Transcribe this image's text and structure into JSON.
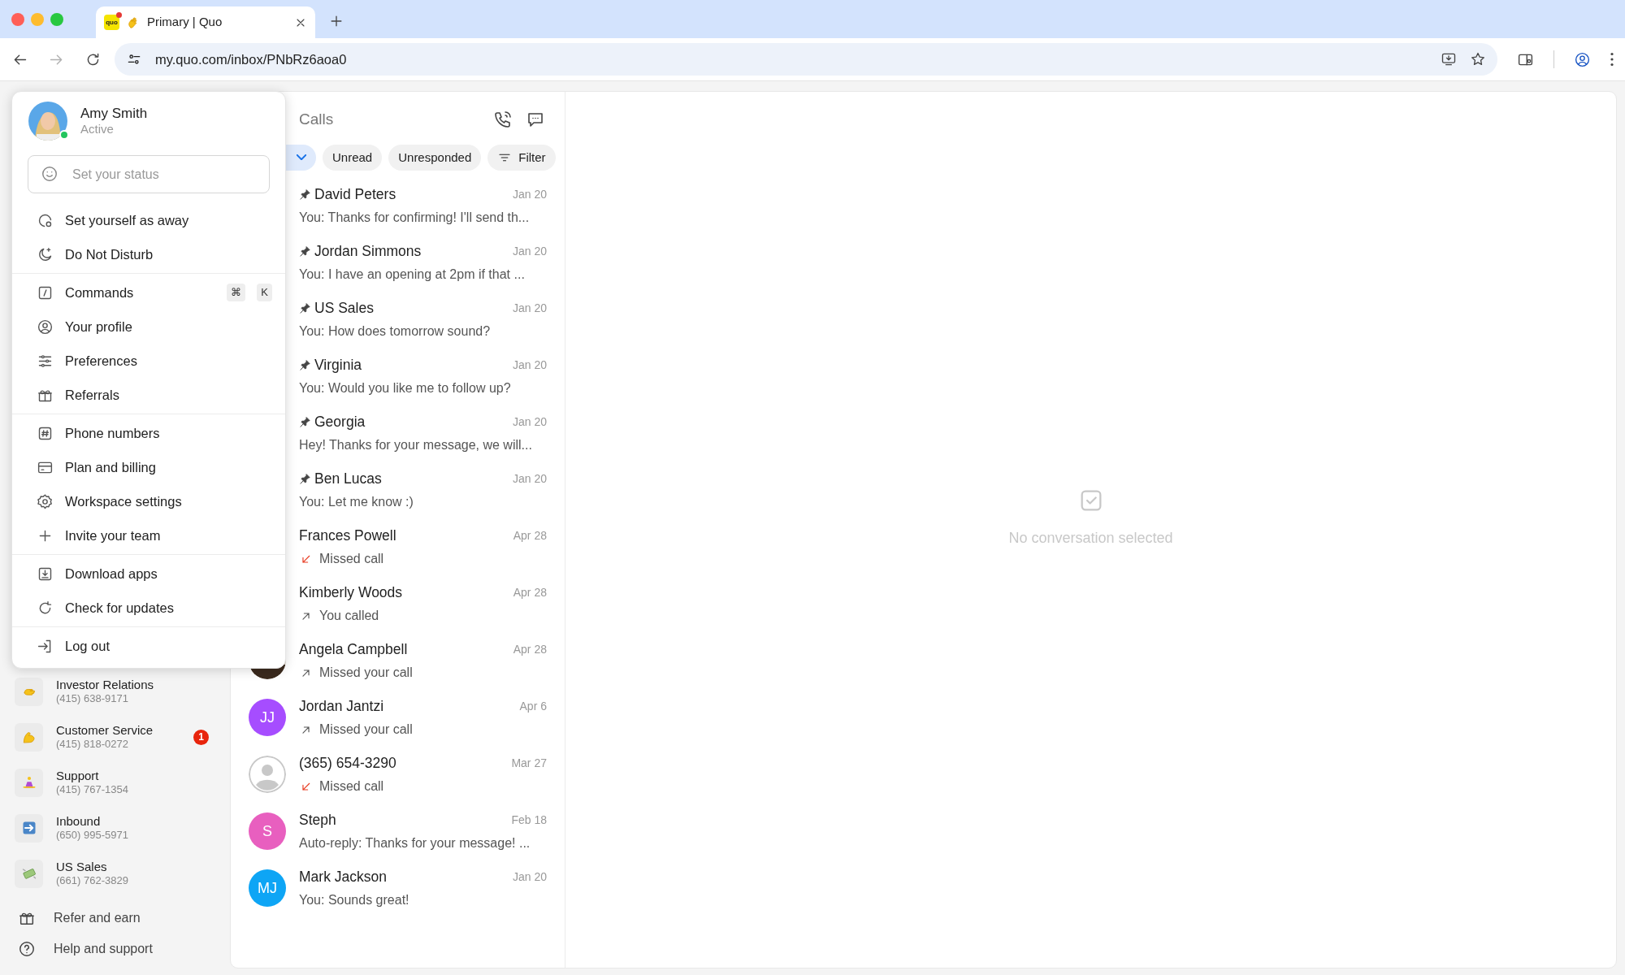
{
  "browser": {
    "tab": {
      "favicon": "quo",
      "title": "Primary | Quo"
    },
    "url_host": "my.quo.com",
    "url_path": "/inbox/PNbRz6aoa0",
    "forward_disabled": true
  },
  "sidebar": {
    "numbers": [
      {
        "name": "Investor Relations",
        "phone": "(415) 638-9171"
      },
      {
        "name": "Customer Service",
        "phone": "(415) 818-0272",
        "badge": "1"
      },
      {
        "name": "Support",
        "phone": "(415) 767-1354"
      },
      {
        "name": "Inbound",
        "phone": "(650) 995-5971"
      },
      {
        "name": "US Sales",
        "phone": "(661) 762-3829"
      }
    ],
    "links": [
      {
        "label": "Refer and earn"
      },
      {
        "label": "Help and support"
      }
    ]
  },
  "inbox": {
    "title": "Calls",
    "filters": [
      {
        "kind": "dropdown",
        "selected": true
      },
      {
        "kind": "chip",
        "label": "Unread",
        "selected": false
      },
      {
        "kind": "chip",
        "label": "Unresponded",
        "selected": false
      },
      {
        "kind": "filter",
        "label": "Filter",
        "selected": false
      }
    ],
    "conversations": [
      {
        "name": "David Peters",
        "date": "Jan 20",
        "preview": "You: Thanks for confirming! I'll send th...",
        "pinned": true
      },
      {
        "name": "Jordan Simmons",
        "date": "Jan 20",
        "preview": "You: I have an opening at 2pm if that ...",
        "pinned": true
      },
      {
        "name": "US Sales",
        "date": "Jan 20",
        "preview": "You: How does tomorrow sound?",
        "pinned": true
      },
      {
        "name": "Virginia",
        "date": "Jan 20",
        "preview": "You: Would you like me to follow up?",
        "pinned": true
      },
      {
        "name": "Georgia",
        "date": "Jan 20",
        "preview": "Hey! Thanks for your message, we will...",
        "pinned": true
      },
      {
        "name": "Ben Lucas",
        "date": "Jan 20",
        "preview": "You: Let me know :)",
        "pinned": true
      },
      {
        "name": "Frances Powell",
        "date": "Apr 28",
        "preview": "Missed call",
        "pinned": false,
        "kind": "missed"
      },
      {
        "name": "Kimberly Woods",
        "date": "Apr 28",
        "preview": "You called",
        "pinned": false,
        "kind": "outgoing"
      },
      {
        "name": "Angela Campbell",
        "date": "Apr 28",
        "preview": "Missed your call",
        "pinned": false,
        "kind": "outgoing"
      },
      {
        "name": "Jordan Jantzi",
        "date": "Apr 6",
        "preview": "Missed your call",
        "pinned": false,
        "kind": "outgoing",
        "avatar": {
          "kind": "initials",
          "initials": "JJ",
          "color": "#a64dff"
        }
      },
      {
        "name": "(365) 654-3290",
        "date": "Mar 27",
        "preview": "Missed call",
        "pinned": false,
        "kind": "missed",
        "avatar": {
          "kind": "unknown"
        }
      },
      {
        "name": "Steph",
        "date": "Feb 18",
        "preview": "Auto-reply: Thanks for your message! ...",
        "pinned": false,
        "avatar": {
          "kind": "initials",
          "initials": "S",
          "color": "#e85fbf"
        }
      },
      {
        "name": "Mark Jackson",
        "date": "Jan 20",
        "preview": "You: Sounds great!",
        "pinned": false,
        "avatar": {
          "kind": "initials",
          "initials": "MJ",
          "color": "#0ea5f5"
        }
      }
    ]
  },
  "detail": {
    "empty_text": "No conversation selected"
  },
  "user_menu": {
    "name": "Amy Smith",
    "status": "Active",
    "online": true,
    "status_placeholder": "Set your status",
    "sections": [
      [
        {
          "label": "Set yourself as away"
        },
        {
          "label": "Do Not Disturb"
        }
      ],
      [
        {
          "label": "Commands",
          "shortcut": [
            "⌘",
            "K"
          ]
        },
        {
          "label": "Your profile"
        },
        {
          "label": "Preferences"
        },
        {
          "label": "Referrals"
        }
      ],
      [
        {
          "label": "Phone numbers"
        },
        {
          "label": "Plan and billing"
        },
        {
          "label": "Workspace settings"
        },
        {
          "label": "Invite your team"
        }
      ],
      [
        {
          "label": "Download apps"
        },
        {
          "label": "Check for updates"
        }
      ],
      [
        {
          "label": "Log out"
        }
      ]
    ]
  }
}
